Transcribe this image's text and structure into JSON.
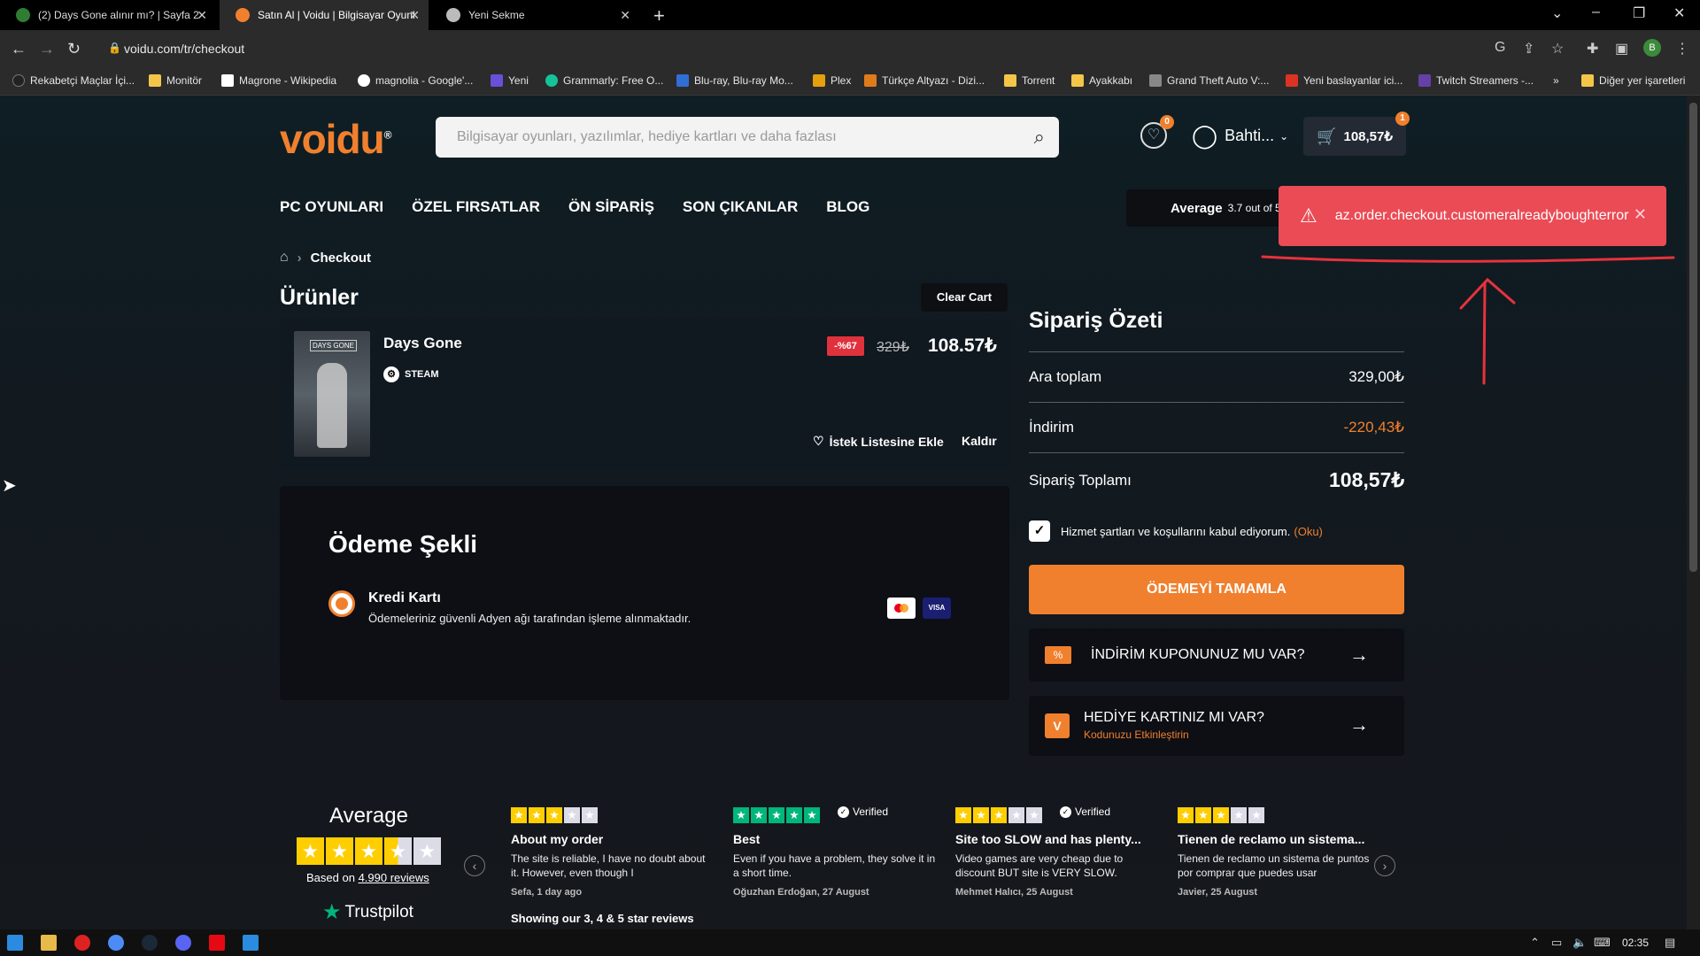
{
  "browser": {
    "tabs": [
      {
        "title": "(2) Days Gone alınır mı? | Sayfa 2",
        "active": false
      },
      {
        "title": "Satın Al | Voidu | Bilgisayar Oyunl",
        "active": true
      },
      {
        "title": "Yeni Sekme",
        "active": false
      }
    ],
    "url": "voidu.com/tr/checkout",
    "profile_initial": "B",
    "bookmarks": [
      "Rekabetçi Maçlar İçi...",
      "Monitör",
      "Magrone - Wikipedia",
      "magnolia - Google'...",
      "Yeni",
      "Grammarly: Free O...",
      "Blu-ray, Blu-ray Mo...",
      "Plex",
      "Türkçe Altyazı - Dizi...",
      "Torrent",
      "Ayakkabı",
      "Grand Theft Auto V:...",
      "Yeni baslayanlar ici...",
      "Twitch Streamers -..."
    ],
    "bookmarks_more": "»",
    "other_bookmarks": "Diğer yer işaretleri"
  },
  "site": {
    "logo": "voidu",
    "logo_mark": "®",
    "search_placeholder": "Bilgisayar oyunları, yazılımlar, hediye kartları ve daha fazlası",
    "wishlist_count": "0",
    "user_name": "Bahti...",
    "cart_count": "1",
    "cart_total": "108,57₺",
    "nav": [
      "PC OYUNLARI",
      "ÖZEL FIRSATLAR",
      "ÖN SİPARİŞ",
      "SON ÇIKANLAR",
      "BLOG"
    ],
    "tp_header": "Average",
    "tp_header_sub": "3.7 out of 5",
    "toast_message": "az.order.checkout.customeralreadyboughterror",
    "accent": "#f0802e",
    "error_color": "#ea4b55"
  },
  "checkout": {
    "breadcrumb": "Checkout",
    "products_heading": "Ürünler",
    "clear_cart": "Clear Cart",
    "product": {
      "cover_text": "DAYS GONE",
      "name": "Days Gone",
      "platform": "STEAM",
      "discount": "-%67",
      "old_price": "329₺",
      "price": "108.57₺",
      "wishlist_label": "İstek Listesine Ekle",
      "remove_label": "Kaldır"
    },
    "payment": {
      "heading": "Ödeme Şekli",
      "method": "Kredi Kartı",
      "description": "Ödemeleriniz güvenli Adyen ağı tarafından işleme alınmaktadır.",
      "visa": "VISA"
    },
    "summary": {
      "heading": "Sipariş Özeti",
      "subtotal_label": "Ara toplam",
      "subtotal": "329,00₺",
      "discount_label": "İndirim",
      "discount": "-220,43₺",
      "total_label": "Sipariş Toplamı",
      "total": "108,57₺",
      "terms": "Hizmet şartları ve koşullarını kabul ediyorum.",
      "terms_link": "(Oku)",
      "pay_button": "ÖDEMEYİ TAMAMLA",
      "coupon": "İNDİRİM KUPONUNUZ MU VAR?",
      "gift_title": "HEDİYE KARTINIZ MI VAR?",
      "gift_sub": "Kodunuzu Etkinleştirin"
    }
  },
  "trustpilot": {
    "average": "Average",
    "rating": 3.5,
    "based_on": "Based on",
    "review_count": "4.990 reviews",
    "brand": "Trustpilot",
    "showing": "Showing our 3, 4 & 5 star reviews",
    "reviews": [
      {
        "stars": 3,
        "verified": "",
        "title": "About my order",
        "body": "The site is reliable, I have no doubt about it. However, even though I",
        "author": "Sefa, 1 day ago"
      },
      {
        "stars": 5,
        "verified": "Verified",
        "title": "Best",
        "body": "Even if you have a problem, they solve it in a short time.",
        "author": "Oğuzhan Erdoğan, 27 August"
      },
      {
        "stars": 3,
        "verified": "Verified",
        "title": "Site too SLOW and has plenty...",
        "body": "Video games are very cheap due to discount BUT site is VERY SLOW.",
        "author": "Mehmet Halıcı, 25 August"
      },
      {
        "stars": 3,
        "verified": "",
        "title": "Tienen de reclamo un sistema...",
        "body": "Tienen de reclamo un sistema de puntos por comprar que puedes usar",
        "author": "Javier, 25 August"
      }
    ]
  },
  "taskbar": {
    "time": "02:35"
  }
}
